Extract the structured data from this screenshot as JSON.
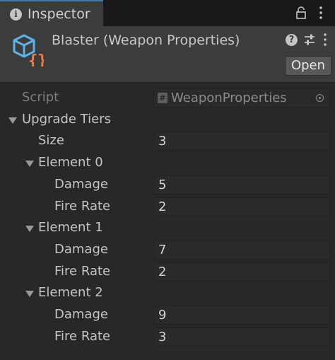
{
  "tab": {
    "label": "Inspector",
    "icon": "info-icon"
  },
  "toolbar": {
    "lock_icon": "lock-icon",
    "menu_icon": "kebab-menu-icon"
  },
  "header": {
    "title": "Blaster (Weapon Properties)",
    "icon": "scriptable-object-icon",
    "open_label": "Open",
    "icons": [
      "help-icon",
      "presets-icon",
      "kebab-menu-icon"
    ]
  },
  "properties": {
    "script": {
      "label": "Script",
      "value": "WeaponProperties"
    },
    "upgrade_tiers": {
      "label": "Upgrade Tiers",
      "size_label": "Size",
      "size": "3",
      "elements": [
        {
          "label": "Element 0",
          "damage_label": "Damage",
          "damage": "5",
          "fire_rate_label": "Fire Rate",
          "fire_rate": "2"
        },
        {
          "label": "Element 1",
          "damage_label": "Damage",
          "damage": "7",
          "fire_rate_label": "Fire Rate",
          "fire_rate": "2"
        },
        {
          "label": "Element 2",
          "damage_label": "Damage",
          "damage": "9",
          "fire_rate_label": "Fire Rate",
          "fire_rate": "3"
        }
      ]
    }
  },
  "colors": {
    "background": "#282828",
    "header": "#3c3c3c",
    "tab_accent": "#3a79bb",
    "icon_blue": "#5ab4e8",
    "icon_orange": "#f07d3c"
  }
}
